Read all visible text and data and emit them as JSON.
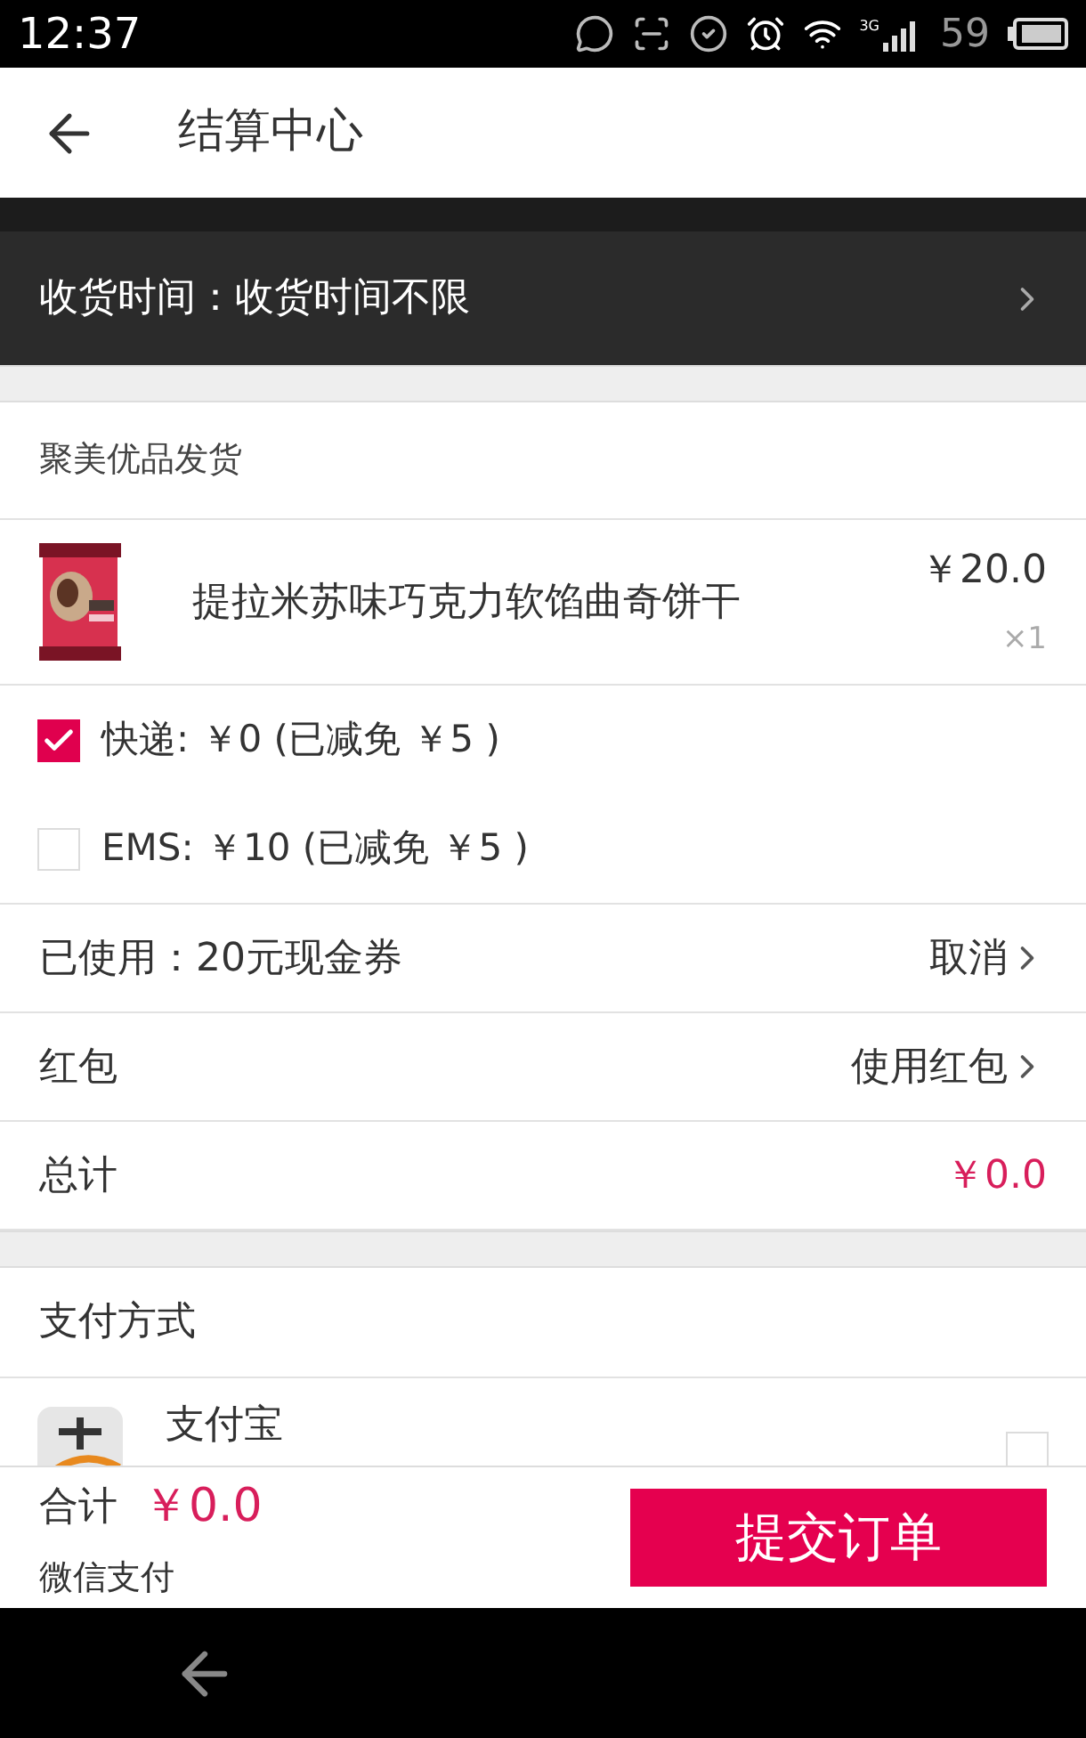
{
  "status_bar": {
    "time": "12:37",
    "network": "3G",
    "battery": "59"
  },
  "header": {
    "title": "结算中心"
  },
  "delivery_time": {
    "label": "收货时间：收货时间不限"
  },
  "shipper": {
    "label": "聚美优品发货"
  },
  "product": {
    "name": "提拉米苏味巧克力软馅曲奇饼干",
    "price": "￥20.0",
    "quantity": "×1"
  },
  "shipping_options": [
    {
      "label": "快递: ￥0 (已减免 ￥5 )",
      "selected": true
    },
    {
      "label": "EMS: ￥10 (已减免 ￥5 )",
      "selected": false
    }
  ],
  "rows": [
    {
      "label": "已使用：20元现金券",
      "value": "取消",
      "kind": "link"
    },
    {
      "label": "红包",
      "value": "使用红包",
      "kind": "link"
    },
    {
      "label": "总计",
      "value": "￥0.0",
      "kind": "amount"
    }
  ],
  "payment": {
    "title": "支付方式",
    "methods": [
      {
        "name": "支付宝",
        "selected": false
      }
    ]
  },
  "footer": {
    "total_label": "合计",
    "total": "￥0.0",
    "payment_method": "微信支付",
    "submit": "提交订单"
  }
}
